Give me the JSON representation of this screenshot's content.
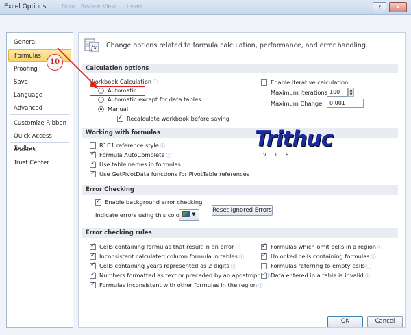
{
  "window": {
    "title": "Excel Options",
    "ghost_tabs": [
      "Data",
      "Review",
      "View",
      "Insert"
    ],
    "help_btn": "?",
    "close_btn": "✕"
  },
  "sidebar": {
    "items": [
      {
        "label": "General"
      },
      {
        "label": "Formulas",
        "active": true
      },
      {
        "label": "Proofing"
      },
      {
        "label": "Save"
      },
      {
        "label": "Language"
      },
      {
        "label": "Advanced"
      },
      {
        "label": "Customize Ribbon"
      },
      {
        "label": "Quick Access Toolbar"
      },
      {
        "label": "Add-Ins"
      },
      {
        "label": "Trust Center"
      }
    ]
  },
  "header": {
    "text": "Change options related to formula calculation, performance, and error handling.",
    "icon": "fx-formula-icon"
  },
  "calc": {
    "section": "Calculation options",
    "workbook_calc": "Workbook Calculation",
    "automatic": "Automatic",
    "automatic_except": "Automatic except for data tables",
    "manual": "Manual",
    "recalc": "Recalculate workbook before saving",
    "enable_iterative": "Enable iterative calculation",
    "max_iter_label": "Maximum Iterations:",
    "max_iter_value": "100",
    "max_change_label": "Maximum Change:",
    "max_change_value": "0.001"
  },
  "working": {
    "section": "Working with formulas",
    "items": [
      {
        "label": "R1C1 reference style",
        "checked": false
      },
      {
        "label": "Formula AutoComplete",
        "checked": true
      },
      {
        "label": "Use table names in formulas",
        "checked": true
      },
      {
        "label": "Use GetPivotData functions for PivotTable references",
        "checked": true
      }
    ]
  },
  "errcheck": {
    "section": "Error Checking",
    "enable_bg": "Enable background error checking",
    "indicate": "Indicate errors using this color:",
    "reset_btn": "Reset Ignored Errors"
  },
  "rules": {
    "section": "Error checking rules",
    "left": [
      {
        "label": "Cells containing formulas that result in an error",
        "checked": true
      },
      {
        "label": "Inconsistent calculated column formula in tables",
        "checked": true
      },
      {
        "label": "Cells containing years represented as 2 digits",
        "checked": true
      },
      {
        "label": "Numbers formatted as text or preceded by an apostrophe",
        "checked": true
      },
      {
        "label": "Formulas inconsistent with other formulas in the region",
        "checked": true
      }
    ],
    "right": [
      {
        "label": "Formulas which omit cells in a region",
        "checked": true
      },
      {
        "label": "Unlocked cells containing formulas",
        "checked": true
      },
      {
        "label": "Formulas referring to empty cells",
        "checked": false
      },
      {
        "label": "Data entered in a table is invalid",
        "checked": true
      }
    ]
  },
  "footer": {
    "ok": "OK",
    "cancel": "Cancel"
  },
  "annotation": {
    "step": "10",
    "color": "#e02222"
  },
  "watermark": {
    "logo_text": "Trithuc",
    "sub": "VIET"
  }
}
